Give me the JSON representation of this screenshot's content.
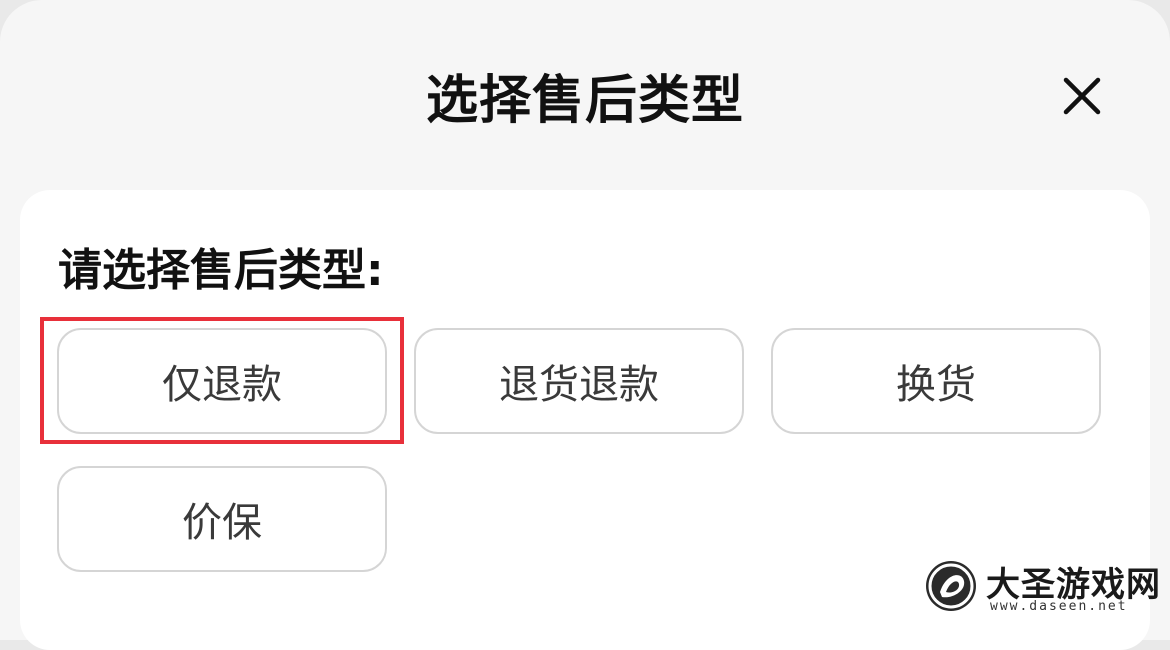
{
  "sheet": {
    "title": "选择售后类型",
    "close_icon": "close-icon"
  },
  "card": {
    "prompt": "请选择售后类型:",
    "options": [
      {
        "label": "仅退款",
        "highlighted": true
      },
      {
        "label": "退货退款",
        "highlighted": false
      },
      {
        "label": "换货",
        "highlighted": false
      },
      {
        "label": "价保",
        "highlighted": false
      }
    ]
  },
  "watermark": {
    "name": "大圣游戏网",
    "url": "www.daseen.net"
  },
  "colors": {
    "highlight_border": "#e8303a",
    "option_border": "#d5d5d5",
    "sheet_bg": "#f6f6f6",
    "card_bg": "#ffffff"
  }
}
